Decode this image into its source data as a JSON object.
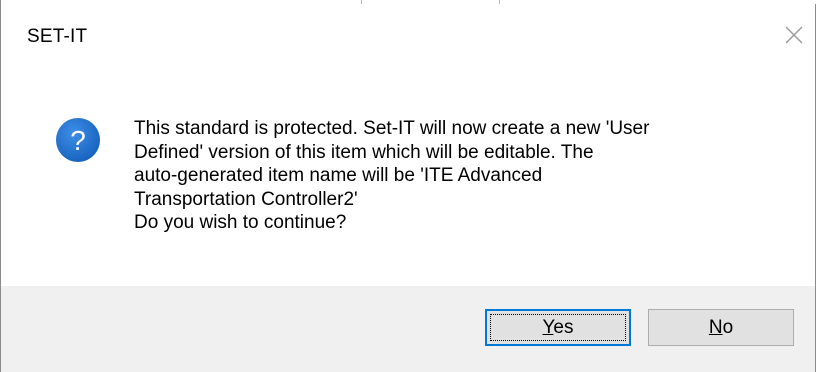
{
  "window": {
    "title": "SET-IT"
  },
  "icons": {
    "close": "close-icon",
    "question": "question-icon"
  },
  "colors": {
    "question_icon": "#1c6fc9",
    "default_button_border": "#0078d7",
    "footer_bg": "#f0f0f0"
  },
  "message": {
    "lines": [
      "This standard is protected. Set-IT will now create a new 'User",
      "Defined' version of this item which will be editable. The",
      "auto-generated item name will be 'ITE Advanced",
      "Transportation Controller2'",
      "Do you wish to continue?"
    ]
  },
  "buttons": {
    "yes": {
      "mnemonic": "Y",
      "rest": "es"
    },
    "no": {
      "mnemonic": "N",
      "rest": "o"
    }
  }
}
